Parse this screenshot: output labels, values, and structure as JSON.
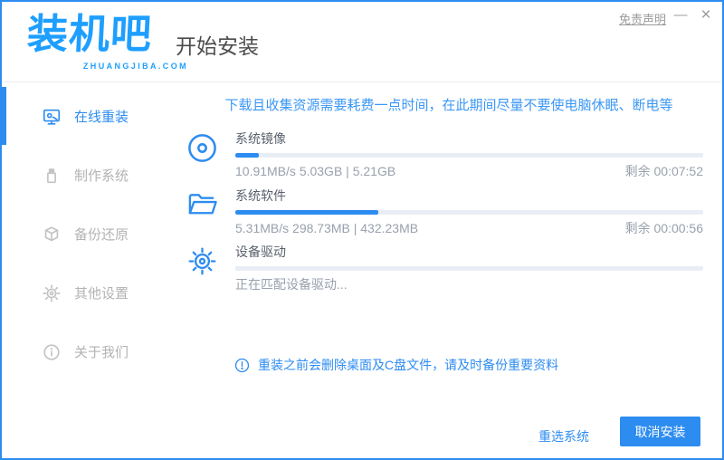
{
  "window": {
    "disclaimer": "免责声明",
    "minimize_glyph": "—",
    "close_glyph": "×"
  },
  "brand": {
    "logo_text": "装机吧",
    "logo_sub": "ZHUANGJIBA.COM"
  },
  "header": {
    "title": "开始安装"
  },
  "sidebar": {
    "items": [
      {
        "label": "在线重装",
        "icon": "monitor-icon",
        "active": true
      },
      {
        "label": "制作系统",
        "icon": "usb-icon",
        "active": false
      },
      {
        "label": "备份还原",
        "icon": "backup-cube-icon",
        "active": false
      },
      {
        "label": "其他设置",
        "icon": "gear-icon",
        "active": false
      },
      {
        "label": "关于我们",
        "icon": "info-icon",
        "active": false
      }
    ]
  },
  "main": {
    "warning": "下载且收集资源需要耗费一点时间，在此期间尽量不要使电脑休眠、断电等",
    "tasks": [
      {
        "name": "系统镜像",
        "progress_percent": 5,
        "stats": "10.91MB/s 5.03GB | 5.21GB",
        "remaining": "剩余 00:07:52"
      },
      {
        "name": "系统软件",
        "progress_percent": 30.5,
        "stats": "5.31MB/s 298.73MB | 432.23MB",
        "remaining": "剩余 00:00:56"
      },
      {
        "name": "设备驱动",
        "progress_percent": 0,
        "stats": "正在匹配设备驱动...",
        "remaining": ""
      }
    ],
    "note": "重装之前会删除桌面及C盘文件，请及时备份重要资料"
  },
  "footer": {
    "reselect_label": "重选系统",
    "cancel_label": "取消安装"
  },
  "colors": {
    "accent": "#2d8cf0",
    "logo_blue": "#1e9fff",
    "warning_text": "#3b97f5",
    "progress_track": "#e9eef6",
    "window_border": "#2e8cf0",
    "inactive_gray": "#b3b3b3"
  }
}
